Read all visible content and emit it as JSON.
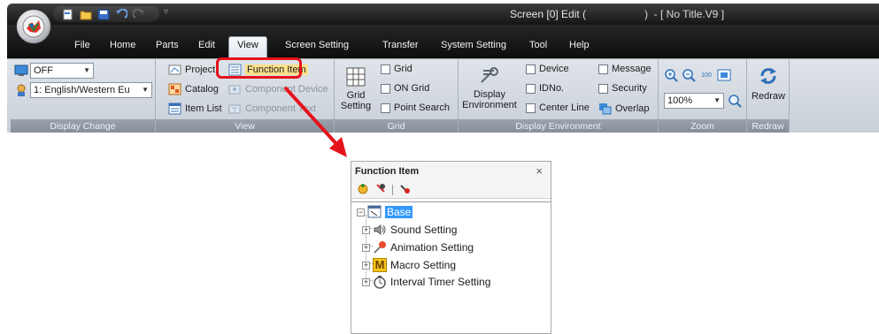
{
  "titlebar": {
    "title": "Screen [0] Edit (",
    "doc": ")  - [ No Title.V9 ]"
  },
  "menu": {
    "tabs": [
      {
        "label": "File"
      },
      {
        "label": "Home"
      },
      {
        "label": "Parts"
      },
      {
        "label": "Edit"
      },
      {
        "label": "View",
        "active": true
      },
      {
        "label": "Screen Setting"
      },
      {
        "label": "Transfer"
      },
      {
        "label": "System Setting"
      },
      {
        "label": "Tool"
      },
      {
        "label": "Help"
      }
    ]
  },
  "ribbon": {
    "display_change": {
      "label": "Display Change",
      "display_mode": "OFF",
      "language": "1: English/Western Eu"
    },
    "view": {
      "label": "View",
      "project": "Project",
      "function_item": "Function Item",
      "catalog": "Catalog",
      "component_device": "Component Device",
      "item_list": "Item List",
      "component_text": "Component Text"
    },
    "grid": {
      "label": "Grid",
      "grid_setting_line1": "Grid",
      "grid_setting_line2": "Setting",
      "grid": "Grid",
      "on_grid": "ON Grid",
      "point_search": "Point Search"
    },
    "display_environment": {
      "label": "Display Environment",
      "button_line1": "Display",
      "button_line2": "Environment",
      "device": "Device",
      "message": "Message",
      "idno": "IDNo.",
      "security": "Security",
      "center_line": "Center Line",
      "overlap": "Overlap"
    },
    "zoom": {
      "label": "Zoom",
      "value": "100%",
      "fit_label": "100"
    },
    "redraw": {
      "label": "Redraw",
      "button": "Redraw"
    }
  },
  "function_item_pane": {
    "title": "Function Item",
    "close": "×",
    "tree": {
      "root": "Base",
      "children": [
        {
          "label": "Sound Setting"
        },
        {
          "label": "Animation Setting"
        },
        {
          "label": "Macro Setting",
          "icon_letter": "M"
        },
        {
          "label": "Interval Timer Setting"
        }
      ]
    }
  },
  "colors": {
    "highlight": "#e5131b",
    "selection": "#3399ff"
  }
}
